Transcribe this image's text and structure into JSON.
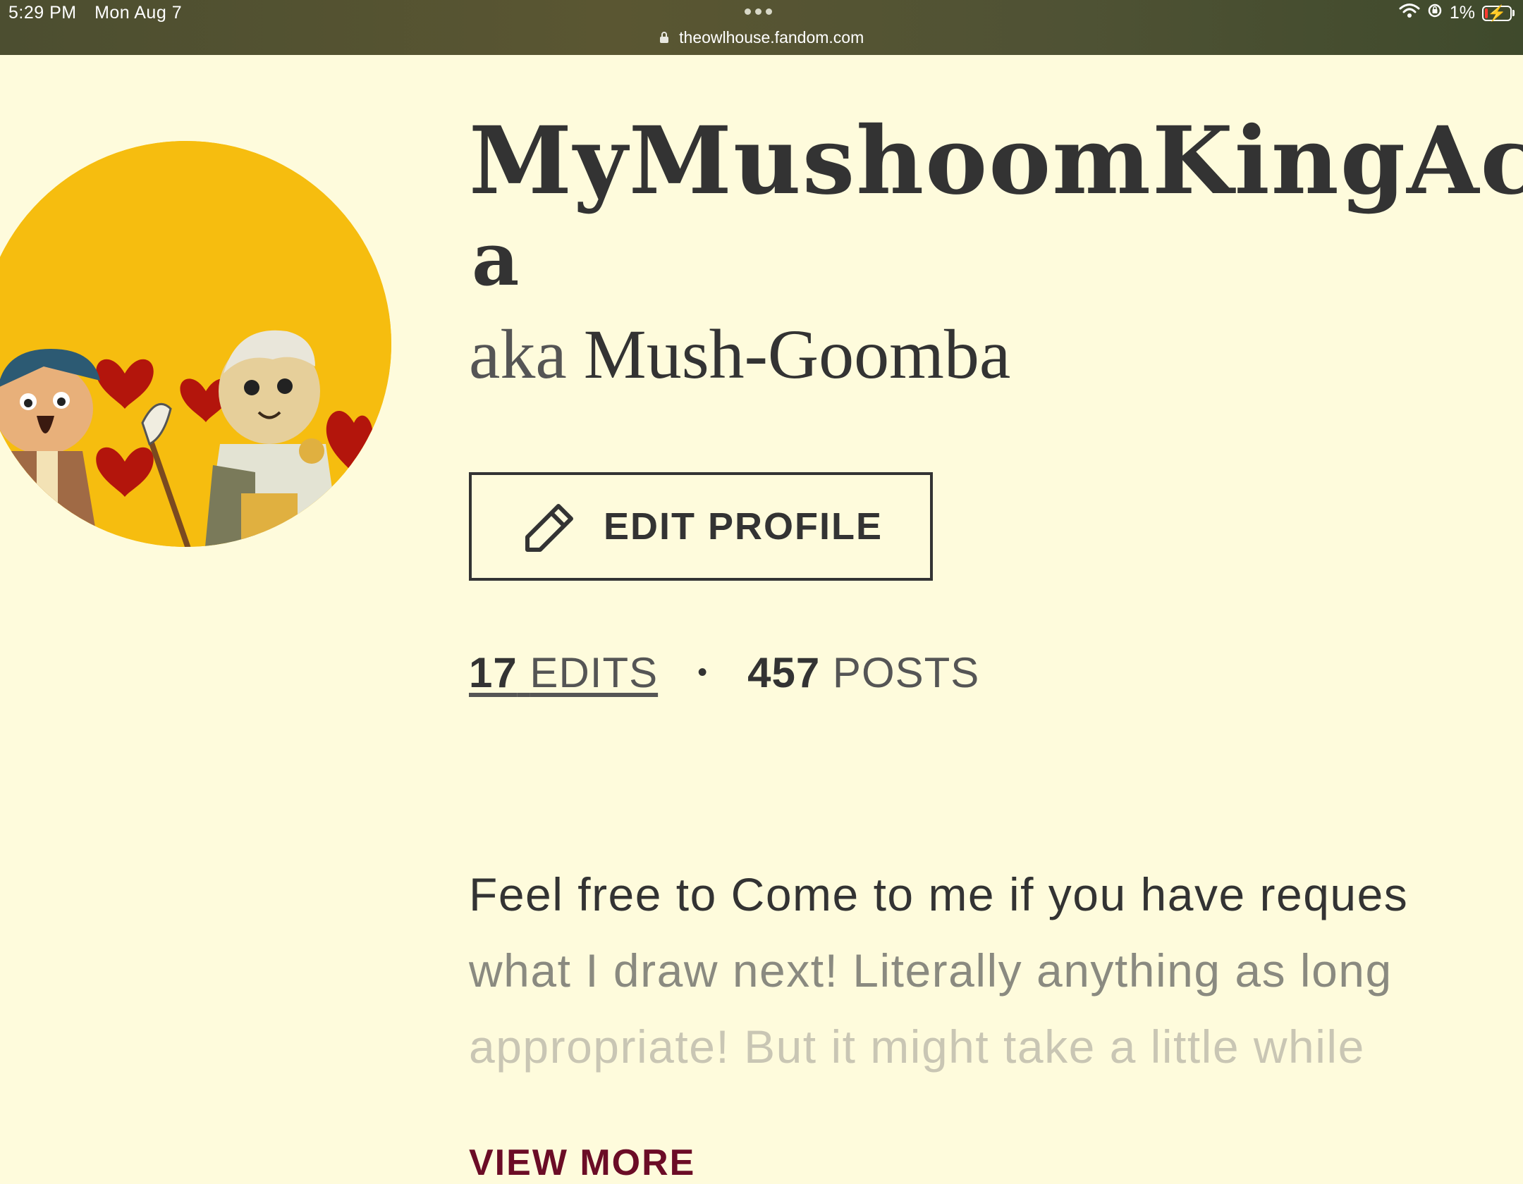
{
  "status_bar": {
    "time": "5:29 PM",
    "date": "Mon Aug 7",
    "url": "theowlhouse.fandom.com",
    "battery_percent": "1%",
    "icons": [
      "wifi-icon",
      "orientation-lock-icon",
      "battery-charging-icon",
      "lock-icon",
      "more-dots-icon"
    ]
  },
  "profile": {
    "username_line1": "MyMushoomKingAcad",
    "username_line2": "a",
    "aka_label": "aka",
    "aka_name": "Mush-Goomba",
    "edit_button_label": "EDIT PROFILE",
    "stats": {
      "edits_count": "17",
      "edits_label": "EDITS",
      "separator": "•",
      "posts_count": "457",
      "posts_label": "POSTS"
    },
    "bio_lines": [
      "Feel free to Come to me if you have reques",
      "what I draw next! Literally anything as long",
      "appropriate! But it might take a little while"
    ],
    "view_more_label": "VIEW MORE"
  },
  "colors": {
    "page_background": "#fefbdc",
    "text": "#333333",
    "accent": "#6b0c26",
    "avatar_background": "#f6bd0f"
  }
}
